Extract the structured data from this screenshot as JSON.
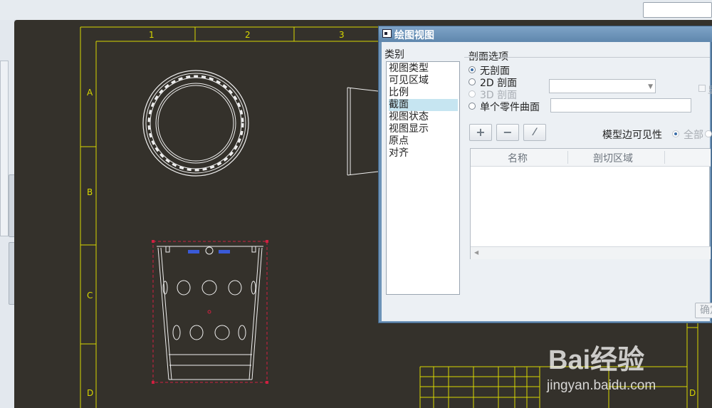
{
  "dialog": {
    "title": "绘图视图",
    "category_label": "类别",
    "categories": [
      "视图类型",
      "可见区域",
      "比例",
      "截面",
      "视图状态",
      "视图显示",
      "原点",
      "对齐"
    ],
    "selected_category": "截面",
    "section_options_label": "剖面选项",
    "options": {
      "no_section": "无剖面",
      "section_2d": "2D 剖面",
      "section_3d": "3D 剖面",
      "single_part_surface": "单个零件曲面"
    },
    "checkbox_label": "显",
    "model_edge_visibility": "模型边可见性",
    "visibility_all": "全部",
    "table_headers": [
      "名称",
      "剖切区域"
    ],
    "ok_button": "确定",
    "toolbar": {
      "add": "+",
      "remove": "−",
      "flip": "⁄"
    }
  },
  "drawing": {
    "column_labels": [
      "1",
      "2",
      "3"
    ],
    "row_labels_left": [
      "A",
      "B",
      "C",
      "D"
    ],
    "row_label_right": "D"
  },
  "watermark": {
    "text": "Bai经验",
    "url": "jingyan.baidu.com"
  },
  "colors": {
    "canvas": "#34312b",
    "frame": "#d8d800",
    "dialog_border": "#6d93b8",
    "selected_item": "#c6e5f1"
  }
}
